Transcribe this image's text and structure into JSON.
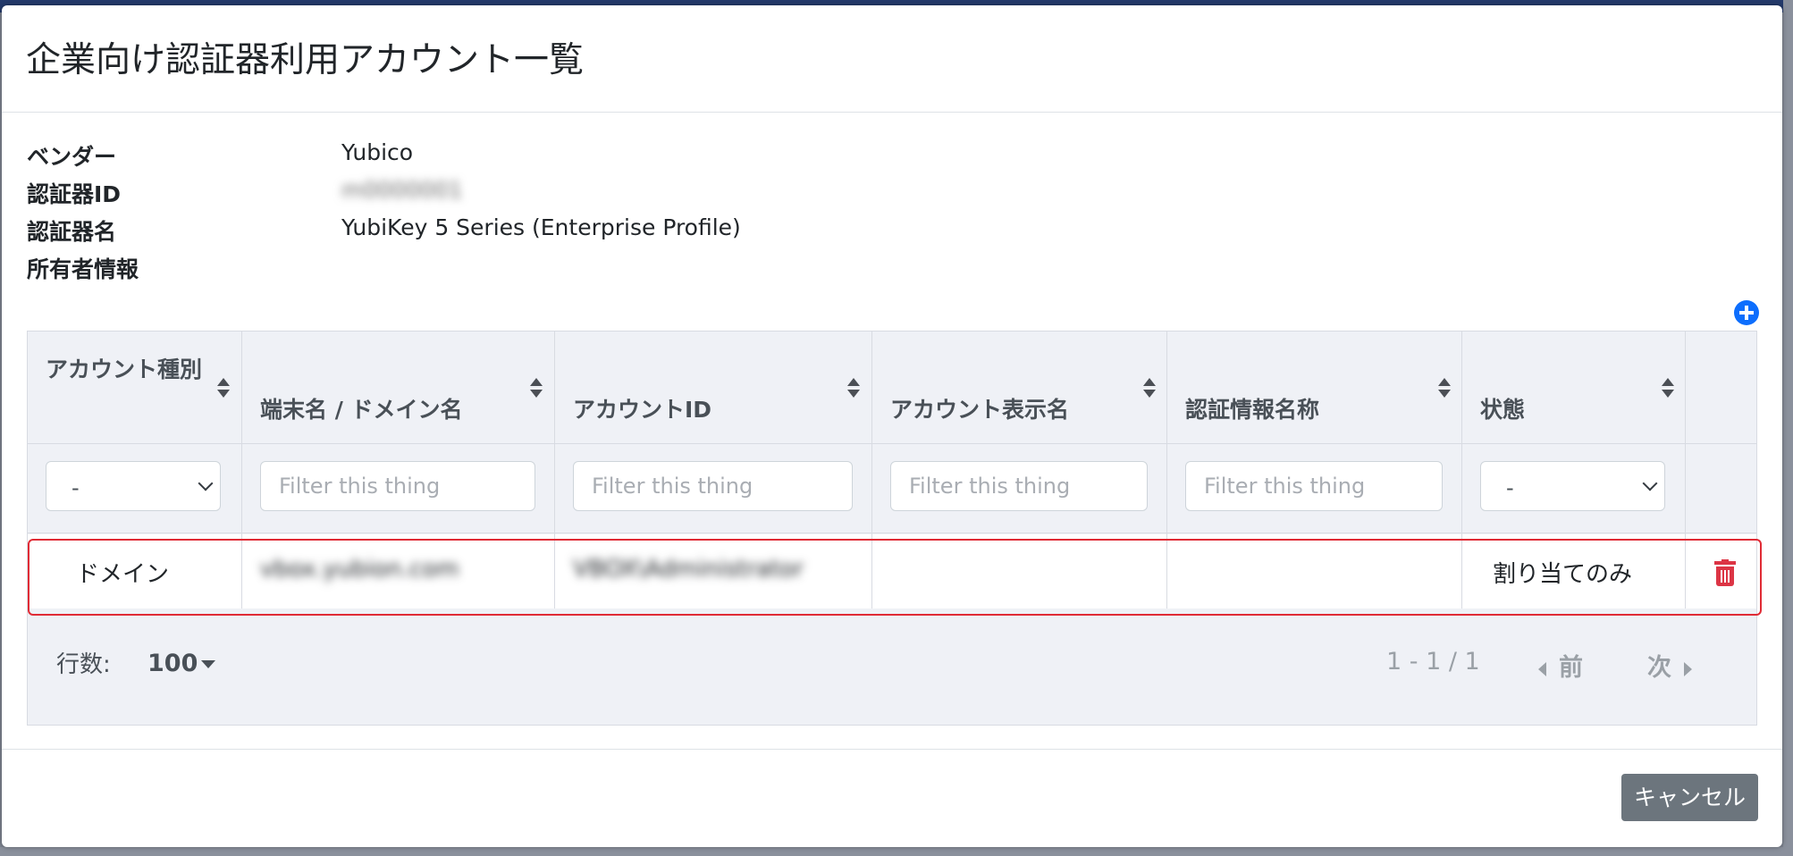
{
  "modal": {
    "title": "企業向け認証器利用アカウント一覧"
  },
  "info": {
    "vendor_label": "ベンダー",
    "vendor_value": "Yubico",
    "authenticator_id_label": "認証器ID",
    "authenticator_id_value": "m0000001",
    "authenticator_name_label": "認証器名",
    "authenticator_name_value": "YubiKey 5 Series (Enterprise Profile)",
    "owner_label": "所有者情報",
    "owner_value": ""
  },
  "add_icon": "plus-circle-icon",
  "table": {
    "columns": [
      {
        "label": "アカウント種別"
      },
      {
        "label": "端末名 / ドメイン名"
      },
      {
        "label": "アカウントID"
      },
      {
        "label": "アカウント表示名"
      },
      {
        "label": "認証情報名称"
      },
      {
        "label": "状態"
      }
    ],
    "filters": {
      "account_type_selected": "-",
      "terminal_placeholder": "Filter this thing",
      "account_id_placeholder": "Filter this thing",
      "display_name_placeholder": "Filter this thing",
      "credential_name_placeholder": "Filter this thing",
      "status_selected": "-"
    },
    "rows": [
      {
        "account_type": "ドメイン",
        "terminal": "vbox.yubion.com",
        "account_id": "VBOX\\Administrator",
        "display_name": "",
        "credential_name": "",
        "status": "割り当てのみ",
        "delete_icon": "trash-icon"
      }
    ]
  },
  "footer": {
    "rows_label": "行数:",
    "rows_per_page": "100",
    "range": "1 - 1 / 1",
    "prev": "前",
    "next": "次"
  },
  "cancel_label": "キャンセル",
  "colors": {
    "accent": "#0d6efd",
    "danger": "#dc3545",
    "highlight_border": "#e02b35",
    "secondary_button": "#6c757d",
    "table_bg": "#eff1f6"
  }
}
